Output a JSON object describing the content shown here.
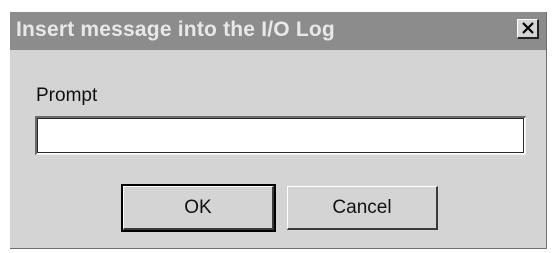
{
  "dialog": {
    "title": "Insert message into the I/O Log",
    "close_icon": "close-icon",
    "prompt_label": "Prompt",
    "prompt_value": "",
    "ok_label": "OK",
    "cancel_label": "Cancel"
  }
}
